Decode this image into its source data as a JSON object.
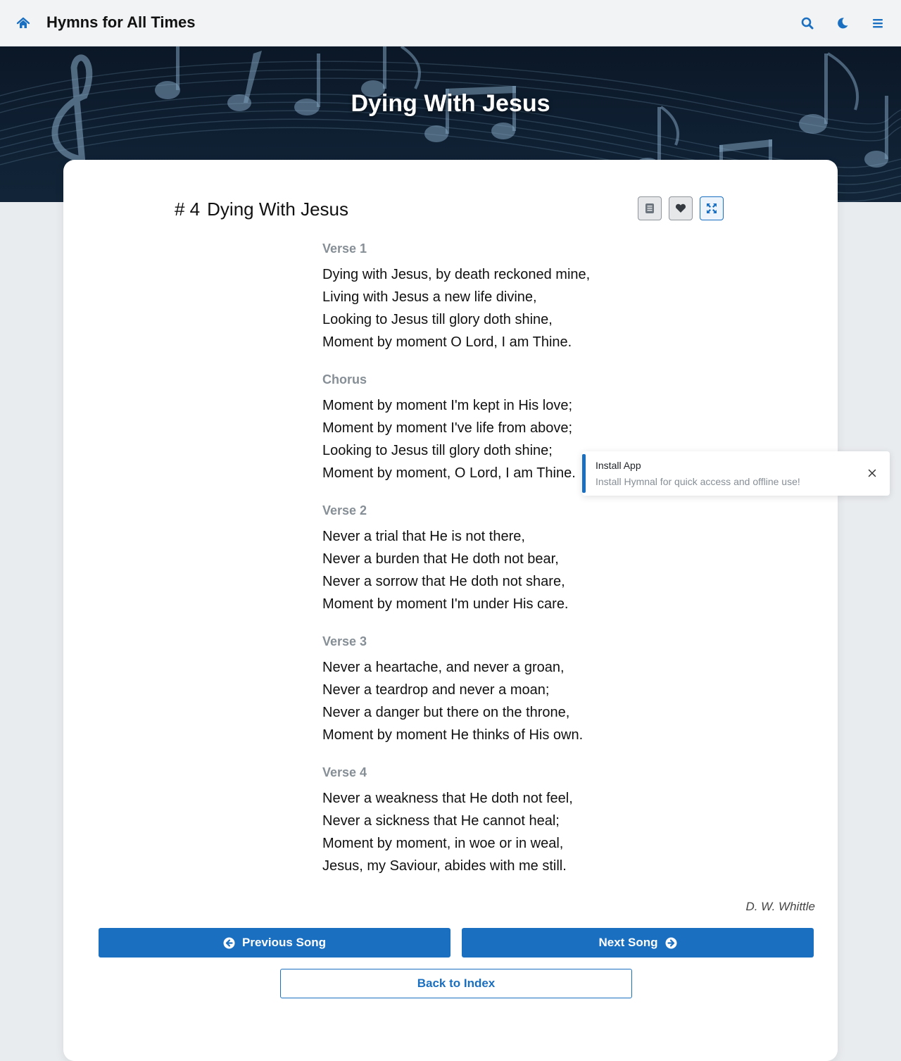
{
  "navbar": {
    "brand": "Hymns for All Times",
    "icons": [
      "home-icon",
      "search-icon",
      "moon-icon",
      "menu-icon"
    ],
    "accent_color": "#1a6fc1"
  },
  "hero": {
    "title": "Dying With Jesus"
  },
  "song": {
    "number": "# 4",
    "title": "Dying With Jesus",
    "toolbar_icons": [
      "sheet-music-icon",
      "heart-icon",
      "expand-icon"
    ],
    "sections": [
      {
        "label": "Verse 1",
        "lines": [
          "Dying with Jesus, by death reckoned mine,",
          "Living with Jesus a new life divine,",
          "Looking to Jesus till glory doth shine,",
          "Moment by moment O Lord, I am Thine."
        ]
      },
      {
        "label": "Chorus",
        "lines": [
          "Moment by moment I'm kept in His love;",
          "Moment by moment I've life from above;",
          "Looking to Jesus till glory doth shine;",
          "Moment by moment, O Lord, I am Thine."
        ]
      },
      {
        "label": "Verse 2",
        "lines": [
          "Never a trial that He is not there,",
          "Never a burden that He doth not bear,",
          "Never a sorrow that He doth not share,",
          "Moment by moment I'm under His care."
        ]
      },
      {
        "label": "Verse 3",
        "lines": [
          "Never a heartache, and never a groan,",
          "Never a teardrop and never a moan;",
          "Never a danger but there on the throne,",
          "Moment by moment He thinks of His own."
        ]
      },
      {
        "label": "Verse 4",
        "lines": [
          "Never a weakness that He doth not feel,",
          "Never a sickness that He cannot heal;",
          "Moment by moment, in woe or in weal,",
          "Jesus, my Saviour, abides with me still."
        ]
      }
    ],
    "author": "D. W. Whittle"
  },
  "navigation": {
    "prev_label": "Previous Song",
    "next_label": "Next Song",
    "back_label": "Back to Index"
  },
  "toast": {
    "title": "Install App",
    "message": "Install Hymnal for quick access and offline use!"
  }
}
